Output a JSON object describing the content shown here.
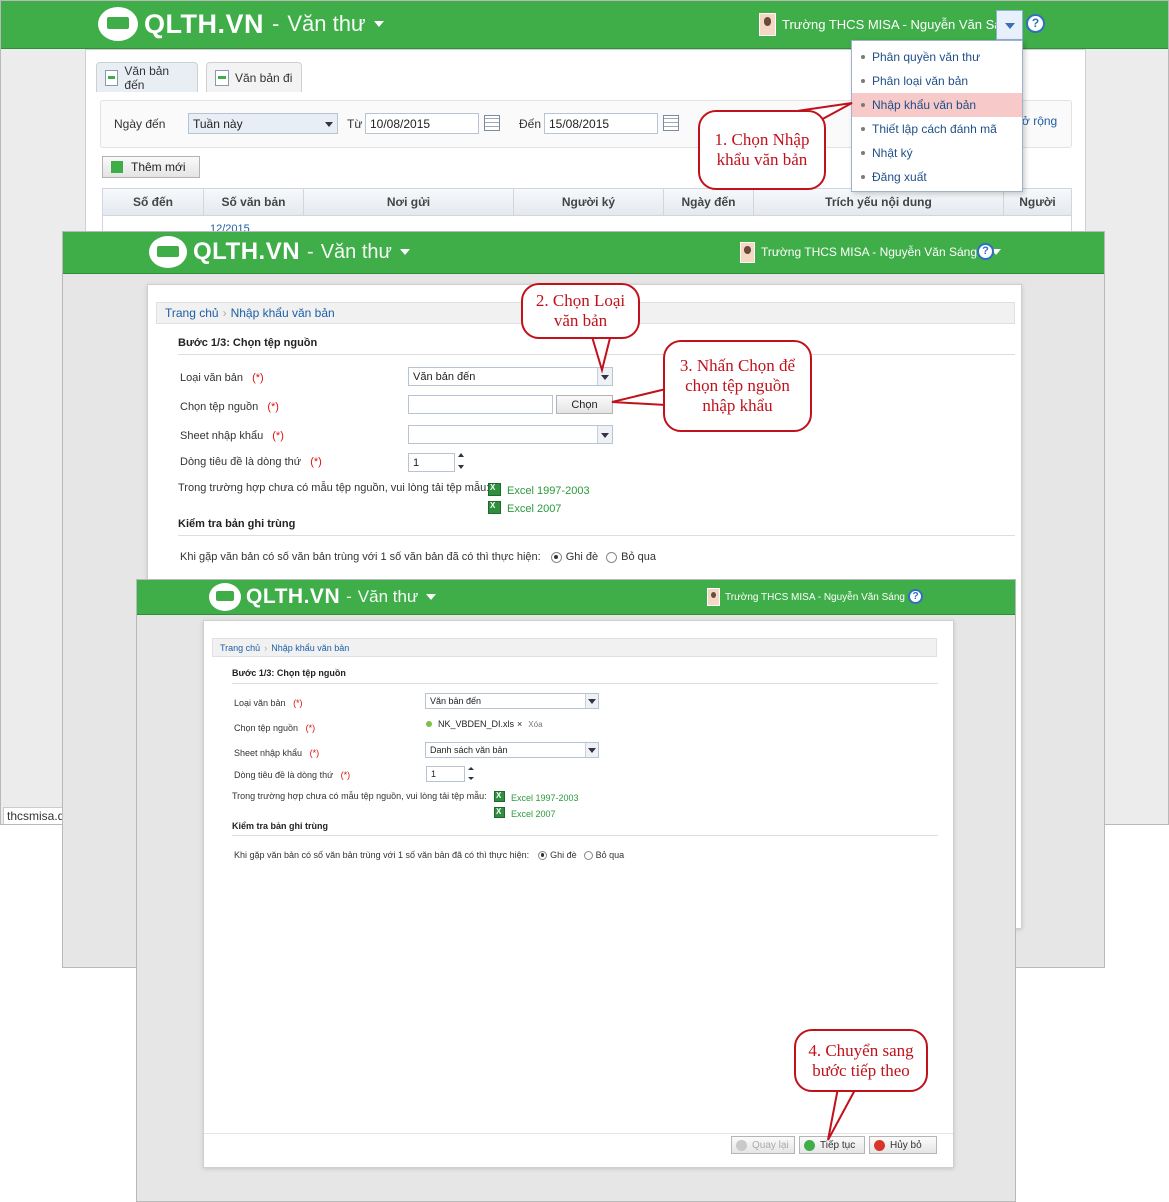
{
  "app": {
    "brand": "QLTH.VN",
    "separator": "-",
    "module": "Văn thư"
  },
  "user": {
    "school_user": "Trường THCS MISA - Nguyễn Văn Sáng",
    "help_glyph": "?"
  },
  "menu": {
    "items": [
      {
        "label": "Phân quyền văn thư"
      },
      {
        "label": "Phân loại văn bản"
      },
      {
        "label": "Nhập khẩu văn bản",
        "highlighted": true
      },
      {
        "label": "Thiết lập cách đánh mã"
      },
      {
        "label": "Nhật ký"
      },
      {
        "label": "Đăng xuất"
      }
    ]
  },
  "list_screen": {
    "tabs": [
      {
        "label": "Văn bản đến",
        "active": true
      },
      {
        "label": "Văn bản đi"
      }
    ],
    "filter": {
      "period_label": "Ngày đến",
      "period_value": "Tuần này",
      "from_label": "Từ",
      "from_value": "10/08/2015",
      "to_label": "Đến",
      "to_value": "15/08/2015",
      "expand_partial": "ở rộng"
    },
    "add_button": "Thêm mới",
    "table": {
      "columns": [
        "Số đến",
        "Số văn bản",
        "Nơi gửi",
        "Người ký",
        "Ngày đến",
        "Trích yếu nội dung",
        "Người"
      ],
      "first_row_partial": "12/2015"
    },
    "status_url": "thcsmisa.d"
  },
  "import_screen": {
    "breadcrumb": {
      "home": "Trang chủ",
      "current": "Nhập khẩu văn bản"
    },
    "step_title": "Bước 1/3: Chọn tệp nguồn",
    "fields": {
      "doc_type_label": "Loại văn bản",
      "doc_type_value": "Văn bản đến",
      "source_label": "Chọn tệp nguồn",
      "choose_button": "Chọn",
      "sheet_label": "Sheet nhập khẩu",
      "header_row_label": "Dòng tiêu đề là dòng thứ",
      "header_row_value": "1",
      "required_mark": "(*)"
    },
    "template_hint": "Trong trường hợp chưa có mẫu tệp nguồn, vui lòng tải tệp mẫu:",
    "template_links": [
      "Excel 1997-2003",
      "Excel 2007"
    ],
    "duplicate_section": "Kiểm tra bản ghi trùng",
    "duplicate_question": "Khi gặp văn bản có số văn bản trùng với 1 số văn bản đã có thì thực hiện:",
    "duplicate_options": [
      {
        "label": "Ghi đè",
        "checked": true
      },
      {
        "label": "Bỏ qua",
        "checked": false
      }
    ]
  },
  "import_screen_filled": {
    "file_name": "NK_VBDEN_DI.xls",
    "remove_glyph": "×",
    "remove_label": "Xóa",
    "sheet_value": "Danh sách văn bản",
    "footer_buttons": [
      "Quay lại",
      "Tiếp tục",
      "Hủy bỏ"
    ]
  },
  "callouts": [
    "1. Chọn Nhập khẩu văn bản",
    "2. Chọn Loại văn bản",
    "3. Nhấn Chọn để chọn tệp nguồn nhập khẩu",
    "4. Chuyển sang bước tiếp theo"
  ],
  "colors": {
    "header_green": "#3fae49",
    "callout_red": "#c1121c",
    "link_blue": "#1d5fa6",
    "excel_green": "#2a9a3a"
  }
}
